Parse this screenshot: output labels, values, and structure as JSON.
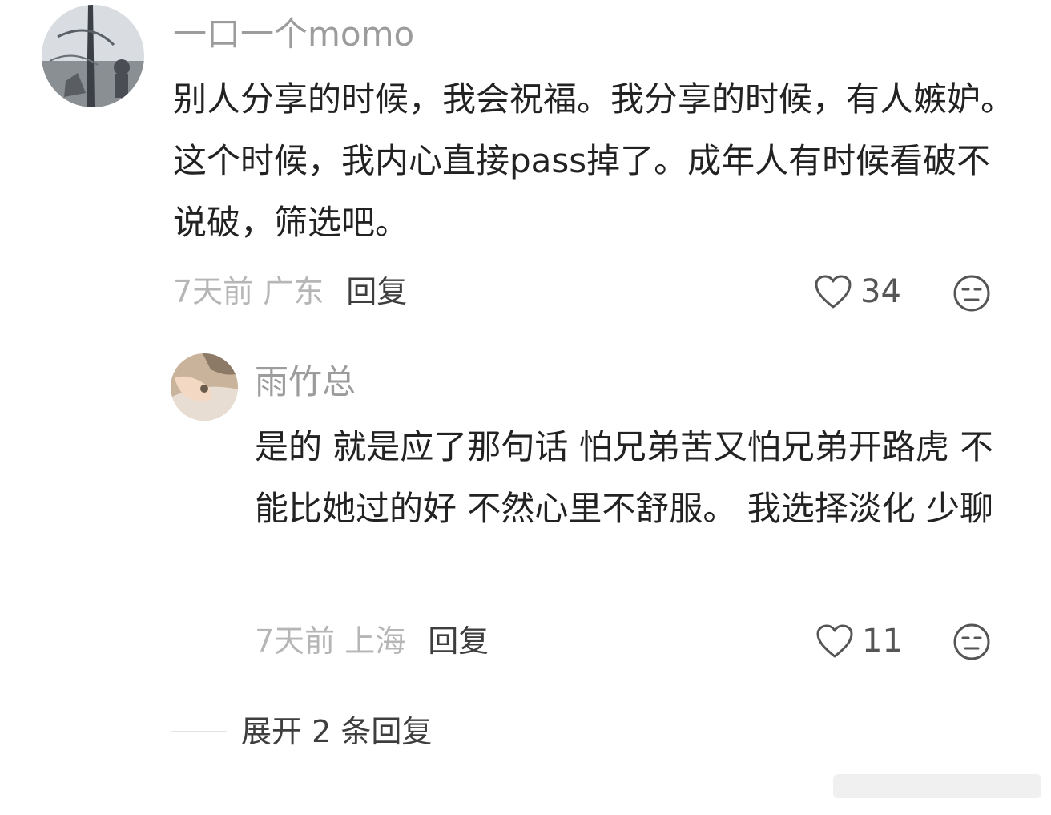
{
  "comments": [
    {
      "username": "一口一个momo",
      "content": "别人分享的时候，我会祝福。我分享的时候，有人嫉妒。这个时候，我内心直接pass掉了。成年人有时候看破不说破，筛选吧。",
      "time_location": "7天前 广东",
      "reply_label": "回复",
      "likes": "34"
    },
    {
      "username": "雨竹总",
      "content": "是的 就是应了那句话 怕兄弟苦又怕兄弟开路虎 不能比她过的好 不然心里不舒服。 我选择淡化 少聊",
      "time_location": "7天前 上海",
      "reply_label": "回复",
      "likes": "11"
    }
  ],
  "expand_replies": "展开 2 条回复",
  "icons": {
    "like": "heart-outline-icon",
    "dislike": "unamused-face-icon"
  }
}
